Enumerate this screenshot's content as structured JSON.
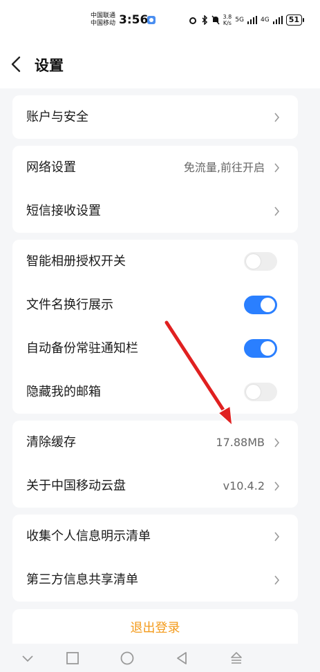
{
  "status_bar": {
    "carrier_1": "中国联通",
    "carrier_2": "中国移动",
    "time": "3:56",
    "speed_value": "3.8",
    "speed_unit": "K/s",
    "net_1": "5G",
    "net_2": "4G",
    "battery": "51",
    "icons": [
      "alarm-icon",
      "bluetooth-icon",
      "mute-icon",
      "signal-icon",
      "signal-icon",
      "battery-icon"
    ]
  },
  "header": {
    "title": "设置"
  },
  "groups": [
    {
      "items": [
        {
          "label": "账户与安全"
        }
      ]
    },
    {
      "items": [
        {
          "label": "网络设置",
          "value": "免流量,前往开启"
        },
        {
          "label": "短信接收设置"
        }
      ]
    },
    {
      "items": [
        {
          "label": "智能相册授权开关",
          "toggle": false
        },
        {
          "label": "文件名换行展示",
          "toggle": true
        },
        {
          "label": "自动备份常驻通知栏",
          "toggle": true
        },
        {
          "label": "隐藏我的邮箱",
          "toggle": false
        }
      ]
    },
    {
      "items": [
        {
          "label": "清除缓存",
          "value": "17.88MB"
        },
        {
          "label": "关于中国移动云盘",
          "value": "v10.4.2"
        }
      ]
    },
    {
      "items": [
        {
          "label": "收集个人信息明示清单"
        },
        {
          "label": "第三方信息共享清单"
        }
      ]
    }
  ],
  "logout": {
    "label": "退出登录"
  },
  "colors": {
    "accent": "#2a7fff",
    "logout": "#f39a1a",
    "annotation_arrow": "#e02020"
  },
  "navbar": {
    "icons": [
      "chevron-down-icon",
      "square-icon",
      "circle-icon",
      "triangle-back-icon",
      "upload-icon"
    ]
  }
}
